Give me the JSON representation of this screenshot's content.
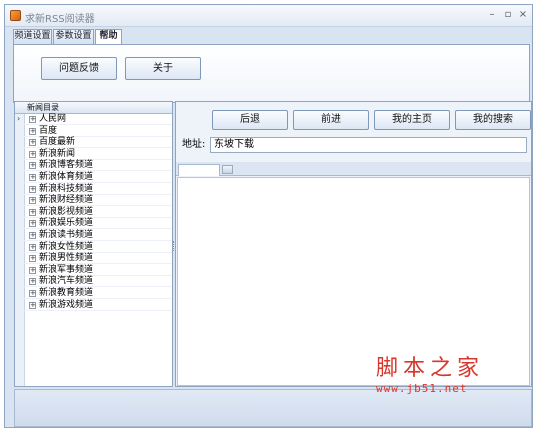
{
  "window": {
    "title": "求新RSS阅读器",
    "minimize_glyph": "–",
    "maximize_glyph": "▫",
    "close_glyph": "×"
  },
  "tabs": [
    {
      "label": "频道设置",
      "active": false
    },
    {
      "label": "参数设置",
      "active": false
    },
    {
      "label": "帮助",
      "active": true
    }
  ],
  "help_panel": {
    "feedback_label": "问题反馈",
    "about_label": "关于"
  },
  "tree": {
    "header": "新闻目录",
    "selected_index": 0,
    "items": [
      "人民网",
      "百度",
      "百度最新",
      "新浪新闻",
      "新浪博客频道",
      "新浪体育频道",
      "新浪科技频道",
      "新浪财经频道",
      "新浪影视频道",
      "新浪娱乐频道",
      "新浪读书频道",
      "新浪女性频道",
      "新浪男性频道",
      "新浪军事频道",
      "新浪汽车频道",
      "新浪教育频道",
      "新浪游戏频道"
    ]
  },
  "browser": {
    "back_label": "后退",
    "forward_label": "前进",
    "home_label": "我的主页",
    "search_label": "我的搜索",
    "address_label": "地址:",
    "address_value": "东坡下载"
  },
  "watermark": {
    "main": "脚本之家",
    "sub": "www.jb51.net"
  },
  "colors": {
    "window_bg": "#d9e4f2",
    "border": "#8fa4c2",
    "watermark": "#d9362b"
  }
}
